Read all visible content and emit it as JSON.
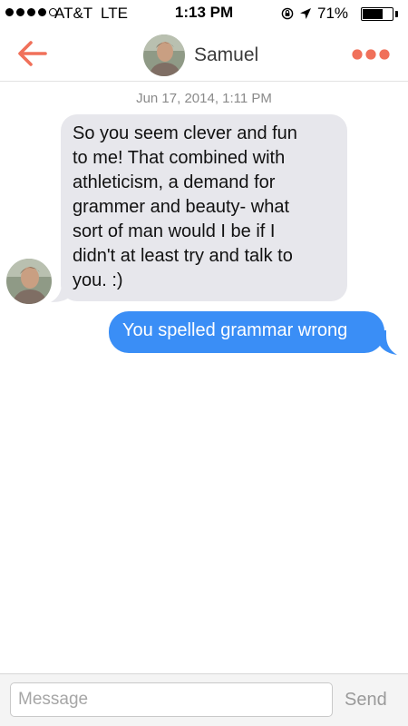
{
  "status_bar": {
    "carrier": "AT&T",
    "network": "LTE",
    "time": "1:13 PM",
    "battery_percent": "71%",
    "battery_level": 0.71,
    "signal_bars_filled": 4,
    "signal_bars_total": 5
  },
  "header": {
    "back_icon": "left-arrow-icon",
    "contact_name": "Samuel",
    "more_icon": "three-dots-icon",
    "accent_color": "#f0705a"
  },
  "conversation": {
    "timestamp": "Jun 17, 2014, 1:11 PM",
    "messages": [
      {
        "direction": "received",
        "text": "So you seem clever and fun\nto me! That combined with\nathleticism, a demand for\ngrammer and beauty- what\nsort of man would I be if I\ndidn't at least try and talk to\nyou.  :)"
      },
      {
        "direction": "sent",
        "text": "You spelled grammar wrong"
      }
    ],
    "received_bubble_color": "#e7e7ec",
    "sent_bubble_color": "#3a8ef6"
  },
  "composer": {
    "placeholder": "Message",
    "value": "",
    "send_label": "Send"
  }
}
